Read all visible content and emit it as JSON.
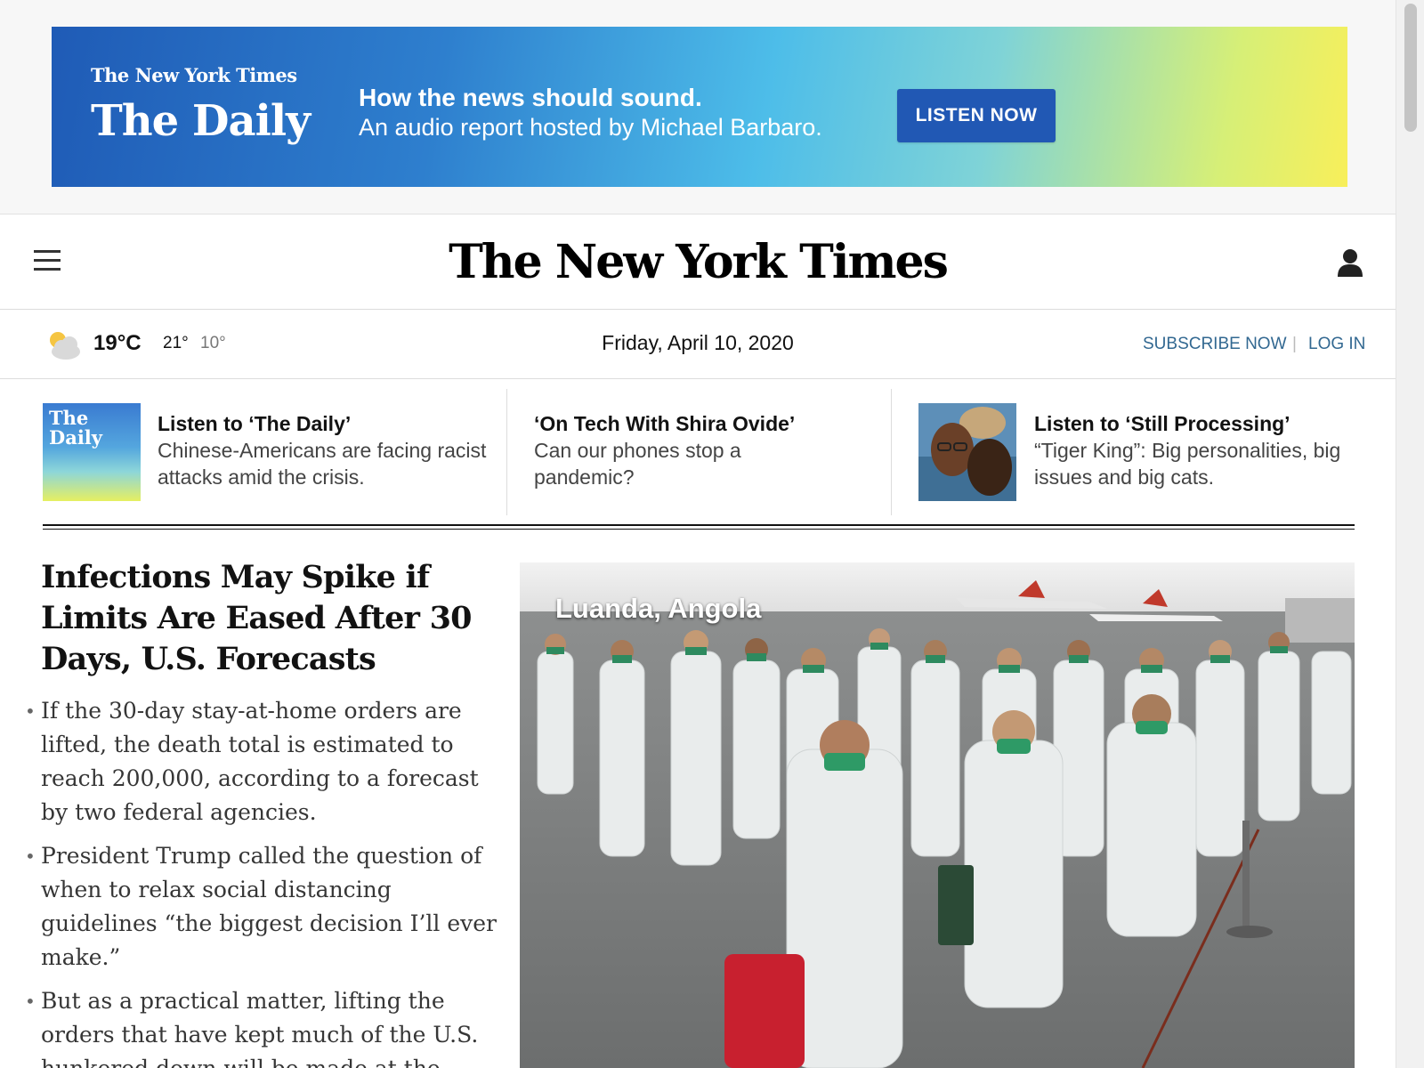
{
  "ad": {
    "brand": "The New York Times",
    "title": "The Daily",
    "headline": "How the news should sound.",
    "subtitle": "An audio report hosted by Michael Barbaro.",
    "cta": "LISTEN NOW"
  },
  "masthead": {
    "logo": "The New York Times"
  },
  "datebar": {
    "temperature": "19°C",
    "high": "21°",
    "low": "10°",
    "date": "Friday, April 10, 2020",
    "subscribe": "SUBSCRIBE NOW",
    "separator": "|",
    "login": "LOG IN",
    "weather_icon": "partly-cloudy-icon"
  },
  "promos": [
    {
      "thumb_text": "The Daily",
      "title": "Listen to ‘The Daily’",
      "text": "Chinese-Americans are facing racist attacks amid the crisis."
    },
    {
      "title": "‘On Tech With Shira Ovide’",
      "text": "Can our phones stop a pandemic?"
    },
    {
      "title": "Listen to ‘Still Processing’",
      "text": "“Tiger King”: Big personalities, big issues and big cats."
    }
  ],
  "lead": {
    "headline": "Infections May Spike if Limits Are Eased After 30 Days, U.S. Forecasts",
    "bullets": [
      "If the 30-day stay-at-home orders are lifted, the death total is estimated to reach 200,000, according to a forecast by two federal agencies.",
      "President Trump called the question of when to relax social distancing guidelines “the biggest decision I’ll ever make.”",
      "But as a practical matter, lifting the orders that have kept much of the U.S. hunkered down will be made at the"
    ],
    "photo_caption": "Luanda, Angola"
  }
}
